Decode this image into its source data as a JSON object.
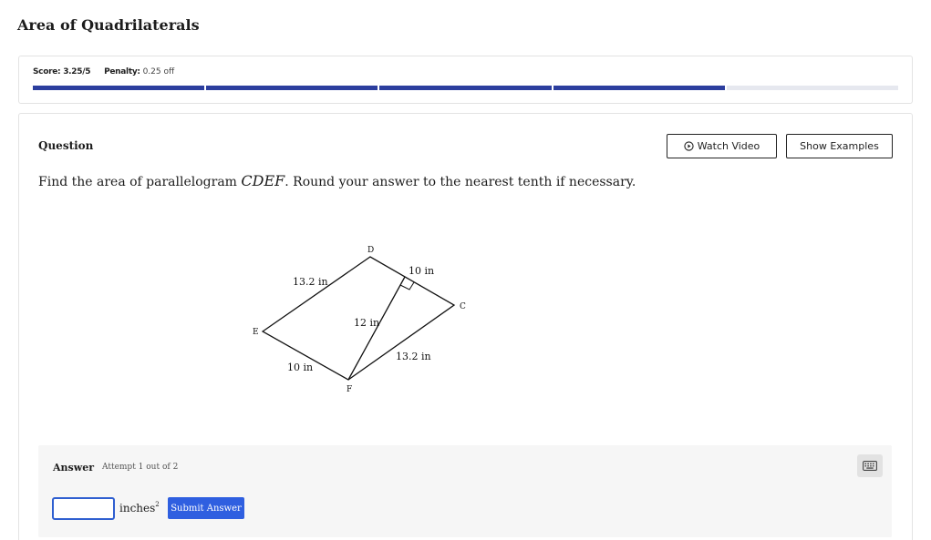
{
  "page": {
    "title": "Area of Quadrilaterals"
  },
  "score": {
    "score_label": "Score:",
    "score_value": "3.25/5",
    "penalty_label": "Penalty:",
    "penalty_value": "0.25 off",
    "progress_segments": 5,
    "progress_filled": 4,
    "fill_color": "#2c3e9e",
    "track_color": "#e6e8ef"
  },
  "question": {
    "label": "Question",
    "watch_video_label": "Watch Video",
    "show_examples_label": "Show Examples",
    "text_before": "Find the area of parallelogram ",
    "math_name": "CDEF",
    "text_after": ". Round your answer to the nearest tenth if necessary."
  },
  "diagram": {
    "vertices": {
      "c": "C",
      "d": "D",
      "e": "E",
      "f": "F"
    },
    "labels": {
      "ed_side": "13.2 in",
      "dc_top": "10 in",
      "height": "12 in",
      "fc_side": "13.2 in",
      "ef_side": "10 in"
    }
  },
  "answer": {
    "title": "Answer",
    "attempt": "Attempt 1 out of 2",
    "input_value": "",
    "unit": "inches",
    "unit_exp": "2",
    "submit_label": "Submit Answer",
    "submit_color": "#2f5fe0"
  },
  "icons": [
    "play-circle-icon",
    "keyboard-icon"
  ]
}
